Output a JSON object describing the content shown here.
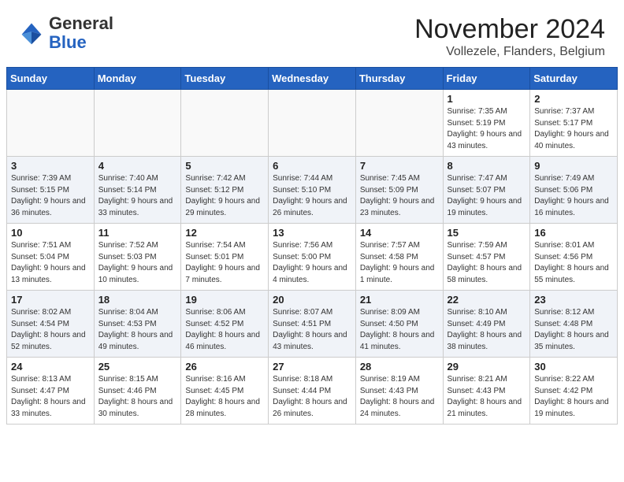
{
  "header": {
    "logo_general": "General",
    "logo_blue": "Blue",
    "month_title": "November 2024",
    "location": "Vollezele, Flanders, Belgium"
  },
  "weekdays": [
    "Sunday",
    "Monday",
    "Tuesday",
    "Wednesday",
    "Thursday",
    "Friday",
    "Saturday"
  ],
  "weeks": [
    [
      {
        "day": "",
        "info": ""
      },
      {
        "day": "",
        "info": ""
      },
      {
        "day": "",
        "info": ""
      },
      {
        "day": "",
        "info": ""
      },
      {
        "day": "",
        "info": ""
      },
      {
        "day": "1",
        "info": "Sunrise: 7:35 AM\nSunset: 5:19 PM\nDaylight: 9 hours and 43 minutes."
      },
      {
        "day": "2",
        "info": "Sunrise: 7:37 AM\nSunset: 5:17 PM\nDaylight: 9 hours and 40 minutes."
      }
    ],
    [
      {
        "day": "3",
        "info": "Sunrise: 7:39 AM\nSunset: 5:15 PM\nDaylight: 9 hours and 36 minutes."
      },
      {
        "day": "4",
        "info": "Sunrise: 7:40 AM\nSunset: 5:14 PM\nDaylight: 9 hours and 33 minutes."
      },
      {
        "day": "5",
        "info": "Sunrise: 7:42 AM\nSunset: 5:12 PM\nDaylight: 9 hours and 29 minutes."
      },
      {
        "day": "6",
        "info": "Sunrise: 7:44 AM\nSunset: 5:10 PM\nDaylight: 9 hours and 26 minutes."
      },
      {
        "day": "7",
        "info": "Sunrise: 7:45 AM\nSunset: 5:09 PM\nDaylight: 9 hours and 23 minutes."
      },
      {
        "day": "8",
        "info": "Sunrise: 7:47 AM\nSunset: 5:07 PM\nDaylight: 9 hours and 19 minutes."
      },
      {
        "day": "9",
        "info": "Sunrise: 7:49 AM\nSunset: 5:06 PM\nDaylight: 9 hours and 16 minutes."
      }
    ],
    [
      {
        "day": "10",
        "info": "Sunrise: 7:51 AM\nSunset: 5:04 PM\nDaylight: 9 hours and 13 minutes."
      },
      {
        "day": "11",
        "info": "Sunrise: 7:52 AM\nSunset: 5:03 PM\nDaylight: 9 hours and 10 minutes."
      },
      {
        "day": "12",
        "info": "Sunrise: 7:54 AM\nSunset: 5:01 PM\nDaylight: 9 hours and 7 minutes."
      },
      {
        "day": "13",
        "info": "Sunrise: 7:56 AM\nSunset: 5:00 PM\nDaylight: 9 hours and 4 minutes."
      },
      {
        "day": "14",
        "info": "Sunrise: 7:57 AM\nSunset: 4:58 PM\nDaylight: 9 hours and 1 minute."
      },
      {
        "day": "15",
        "info": "Sunrise: 7:59 AM\nSunset: 4:57 PM\nDaylight: 8 hours and 58 minutes."
      },
      {
        "day": "16",
        "info": "Sunrise: 8:01 AM\nSunset: 4:56 PM\nDaylight: 8 hours and 55 minutes."
      }
    ],
    [
      {
        "day": "17",
        "info": "Sunrise: 8:02 AM\nSunset: 4:54 PM\nDaylight: 8 hours and 52 minutes."
      },
      {
        "day": "18",
        "info": "Sunrise: 8:04 AM\nSunset: 4:53 PM\nDaylight: 8 hours and 49 minutes."
      },
      {
        "day": "19",
        "info": "Sunrise: 8:06 AM\nSunset: 4:52 PM\nDaylight: 8 hours and 46 minutes."
      },
      {
        "day": "20",
        "info": "Sunrise: 8:07 AM\nSunset: 4:51 PM\nDaylight: 8 hours and 43 minutes."
      },
      {
        "day": "21",
        "info": "Sunrise: 8:09 AM\nSunset: 4:50 PM\nDaylight: 8 hours and 41 minutes."
      },
      {
        "day": "22",
        "info": "Sunrise: 8:10 AM\nSunset: 4:49 PM\nDaylight: 8 hours and 38 minutes."
      },
      {
        "day": "23",
        "info": "Sunrise: 8:12 AM\nSunset: 4:48 PM\nDaylight: 8 hours and 35 minutes."
      }
    ],
    [
      {
        "day": "24",
        "info": "Sunrise: 8:13 AM\nSunset: 4:47 PM\nDaylight: 8 hours and 33 minutes."
      },
      {
        "day": "25",
        "info": "Sunrise: 8:15 AM\nSunset: 4:46 PM\nDaylight: 8 hours and 30 minutes."
      },
      {
        "day": "26",
        "info": "Sunrise: 8:16 AM\nSunset: 4:45 PM\nDaylight: 8 hours and 28 minutes."
      },
      {
        "day": "27",
        "info": "Sunrise: 8:18 AM\nSunset: 4:44 PM\nDaylight: 8 hours and 26 minutes."
      },
      {
        "day": "28",
        "info": "Sunrise: 8:19 AM\nSunset: 4:43 PM\nDaylight: 8 hours and 24 minutes."
      },
      {
        "day": "29",
        "info": "Sunrise: 8:21 AM\nSunset: 4:43 PM\nDaylight: 8 hours and 21 minutes."
      },
      {
        "day": "30",
        "info": "Sunrise: 8:22 AM\nSunset: 4:42 PM\nDaylight: 8 hours and 19 minutes."
      }
    ]
  ]
}
